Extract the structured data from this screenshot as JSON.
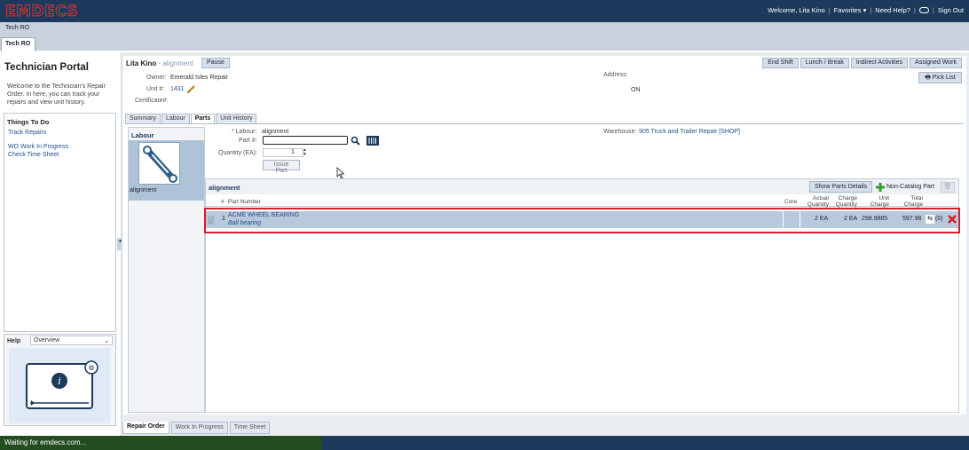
{
  "header": {
    "logo": "EMDECS",
    "welcome": "Welcome, Lita Kino",
    "favorites": "Favorites ▾",
    "need_help": "Need Help?",
    "sign_out": "Sign Out"
  },
  "tabstrip": {
    "label": "Tech RO",
    "active_tab": "Tech RO"
  },
  "left": {
    "title": "Technician Portal",
    "description": "Welcome to the Technician's Repair Order. In here, you can track your repairs and view unit history.",
    "things_to_do": "Things To Do",
    "links": [
      "Track Repairs",
      "WO Work In Progress",
      "Check Time Sheet"
    ],
    "help_label": "Help",
    "help_select": "Overview"
  },
  "ro": {
    "user": "Lita Kino",
    "activity": " - alignment",
    "pause": "Pause",
    "owner_label": "Owner:",
    "owner": "Emerald Isles Repair",
    "unit_label": "Unit #:",
    "unit": "1431",
    "cert_label": "Certificate#:",
    "address_label": "Address:",
    "on": "ON",
    "buttons": [
      "End Shift",
      "Lunch / Break",
      "Indirect Activities",
      "Assigned Work"
    ],
    "pick_list": "Pick List"
  },
  "inner_tabs": [
    "Summary",
    "Labour",
    "Parts",
    "Unit History"
  ],
  "labour": {
    "header": "Labour",
    "item": "alignment"
  },
  "parts_form": {
    "labour_label": "* Labour:",
    "labour_value": "alignment",
    "partno_label": "Part #:",
    "partno_value": "",
    "qty_label": "Quantity (EA):",
    "qty_value": "1",
    "issue": "Issue Part",
    "warehouse_label": "Warehouse:",
    "warehouse_value": "905 Truck and Trailer Repair [SHOP]"
  },
  "grid": {
    "title": "alignment",
    "show_details": "Show Parts Details",
    "non_catalog": "Non-Catalog Part",
    "columns": {
      "num": "#",
      "part": "Part Number",
      "core": "Core",
      "actual_qty": "Actual Quantity",
      "charge_qty": "Charge Quantity",
      "unit_charge": "Unit Charge",
      "total_charge": "Total Charge"
    },
    "rows": [
      {
        "num": "1",
        "part": "ACME WHEEL BEARING",
        "desc": "Ball bearing",
        "core": "",
        "actual_qty": "2 EA",
        "charge_qty": "2 EA",
        "unit_charge": "298.9885",
        "total_charge": "597.98",
        "count": "(0)"
      }
    ]
  },
  "bottom_tabs": [
    "Repair Order",
    "Work In Progress",
    "Time Sheet"
  ],
  "status": "Waiting for emdecs.com...",
  "colors": {
    "header": "#1d3a5c",
    "accent": "#d61f26",
    "row_selected": "#b8c9dc"
  }
}
